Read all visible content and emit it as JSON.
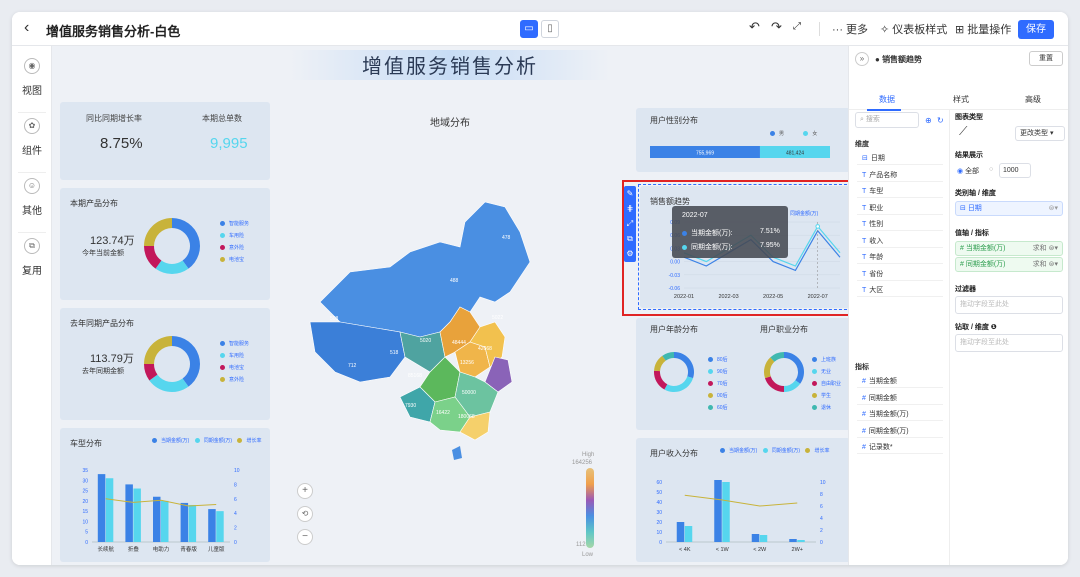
{
  "window": {
    "title": "增值服务销售分析-白色"
  },
  "toolbar": {
    "more": "··· 更多",
    "dashboard_style": "仪表板样式",
    "batch": "批量操作",
    "save": "保存"
  },
  "nav": [
    {
      "label": "视图"
    },
    {
      "label": "组件"
    },
    {
      "label": "其他"
    },
    {
      "label": "复用"
    }
  ],
  "dashboard": {
    "title": "增值服务销售分析"
  },
  "kpi": {
    "yoy_label": "同比同期增长率",
    "yoy_value": "8.75%",
    "orders_label": "本期总单数",
    "orders_value": "9,995"
  },
  "current_product": {
    "title": "本期产品分布",
    "value": "123.74万",
    "caption": "今年当前金额",
    "legend": [
      "智能服务",
      "车用险",
      "意外险",
      "电池宝"
    ]
  },
  "last_product": {
    "title": "去年同期产品分布",
    "value": "113.79万",
    "caption": "去年同期金额",
    "legend": [
      "智能服务",
      "车用险",
      "电池宝",
      "意外险"
    ]
  },
  "car": {
    "title": "车型分布",
    "legend": [
      "当期金额(万)",
      "同期金额(万)",
      "增长率"
    ]
  },
  "region": {
    "title": "地域分布",
    "labels": [
      "478",
      "508",
      "488",
      "5022",
      "5020",
      "518",
      "48444",
      "42668",
      "712",
      "13256",
      "85168",
      "7930",
      "16422",
      "180068",
      "50000"
    ],
    "scale_high": "High",
    "scale_top": "164256",
    "scale_bottom": "112",
    "scale_low": "Low"
  },
  "gender": {
    "title": "用户性别分布",
    "legend": [
      "男",
      "女"
    ],
    "male": "755,969",
    "female": "481,424"
  },
  "sales_trend": {
    "title": "销售额趋势",
    "legend": "同期金额(万)",
    "y_ticks": [
      "0.09",
      "0.06",
      "0.03",
      "0.00",
      "-0.03",
      "-0.06"
    ],
    "x_ticks": [
      "2022-01",
      "2022-03",
      "2022-05",
      "2022-07"
    ]
  },
  "tooltip": {
    "date": "2022-07",
    "row1_label": "当期金额(万):",
    "row1_value": "7.51%",
    "row2_label": "同期金额(万):",
    "row2_value": "7.95%"
  },
  "age": {
    "title": "用户年龄分布",
    "legend": [
      "80后",
      "90后",
      "70后",
      "00后",
      "60后"
    ]
  },
  "job": {
    "title": "用户职业分布",
    "legend": [
      "上班族",
      "无业",
      "自由职业",
      "学生",
      "退休"
    ]
  },
  "income": {
    "title": "用户收入分布",
    "legend": [
      "当期金额(万)",
      "同期金额(万)",
      "增长率"
    ]
  },
  "right_panel": {
    "component": "销售额趋势",
    "reset": "重置",
    "tabs": [
      "数据",
      "样式",
      "高级"
    ],
    "search_placeholder": "搜索",
    "dim_header": "维度",
    "dimensions": [
      "日期",
      "产品名称",
      "车型",
      "职业",
      "性别",
      "收入",
      "年龄",
      "省份",
      "大区"
    ],
    "measure_header": "指标",
    "measures": [
      "当期金额",
      "同期金额",
      "当期金额(万)",
      "同期金额(万)",
      "记录数*"
    ],
    "chart_type_label": "图表类型",
    "change_type": "更改类型",
    "result_label": "结果展示",
    "all": "全部",
    "limit": "1000",
    "category_label": "类别轴 / 维度",
    "category_field": "日期",
    "value_label": "值轴 / 指标",
    "value_field1": "当期金额(万)",
    "value_field2": "同期金额(万)",
    "agg": "求和",
    "filter_label": "过滤器",
    "filter_placeholder": "拖动字段至此处",
    "drill_label": "钻取 / 维度",
    "drill_placeholder": "拖动字段至此处"
  },
  "colors": {
    "accent": "#2f6bff",
    "bar1": "#3b82e6",
    "bar2": "#56d6ee",
    "highlight": "#e02424"
  },
  "chart_data": [
    {
      "type": "pie",
      "title": "本期产品分布",
      "categories": [
        "智能服务",
        "车用险",
        "意外险",
        "电池宝"
      ],
      "values": [
        40,
        20,
        15,
        25
      ]
    },
    {
      "type": "pie",
      "title": "去年同期产品分布",
      "categories": [
        "智能服务",
        "车用险",
        "电池宝",
        "意外险"
      ],
      "values": [
        40,
        25,
        10,
        25
      ]
    },
    {
      "type": "bar",
      "title": "车型分布",
      "categories": [
        "长续航",
        "折叠",
        "电助力",
        "青春版",
        "儿童版"
      ],
      "series": [
        {
          "name": "当期金额(万)",
          "values": [
            33,
            28,
            22,
            19,
            16
          ]
        },
        {
          "name": "同期金额(万)",
          "values": [
            31,
            26,
            20,
            18,
            15
          ]
        },
        {
          "name": "增长率",
          "values": [
            6,
            5.5,
            5.8,
            5,
            5.2
          ]
        }
      ],
      "ylim": [
        0,
        35
      ],
      "y2lim": [
        0,
        10
      ]
    },
    {
      "type": "line",
      "title": "销售额趋势",
      "x": [
        "2022-01",
        "2022-02",
        "2022-03",
        "2022-04",
        "2022-05",
        "2022-06",
        "2022-07",
        "2022-08"
      ],
      "series": [
        {
          "name": "当期金额(万)",
          "values": [
            0.01,
            -0.01,
            0.02,
            0.05,
            0.0,
            -0.02,
            0.07,
            0.01
          ]
        },
        {
          "name": "同期金额(万)",
          "values": [
            0.02,
            0.0,
            0.03,
            0.06,
            0.01,
            -0.01,
            0.08,
            0.02
          ]
        }
      ],
      "ylim": [
        -0.06,
        0.09
      ]
    },
    {
      "type": "bar",
      "title": "用户性别分布",
      "categories": [
        "男",
        "女"
      ],
      "values": [
        755969,
        481424
      ]
    },
    {
      "type": "pie",
      "title": "用户年龄分布",
      "categories": [
        "80后",
        "90后",
        "70后",
        "00后",
        "60后"
      ],
      "values": [
        30,
        28,
        18,
        14,
        10
      ]
    },
    {
      "type": "pie",
      "title": "用户职业分布",
      "categories": [
        "上班族",
        "无业",
        "自由职业",
        "学生",
        "退休"
      ],
      "values": [
        35,
        15,
        20,
        18,
        12
      ]
    },
    {
      "type": "bar",
      "title": "用户收入分布",
      "categories": [
        "< 4K",
        "< 1W",
        "< 2W",
        "2W+"
      ],
      "series": [
        {
          "name": "当期金额(万)",
          "values": [
            20,
            62,
            8,
            3
          ]
        },
        {
          "name": "同期金额(万)",
          "values": [
            16,
            60,
            7,
            2
          ]
        },
        {
          "name": "增长率",
          "values": [
            7.8,
            7.0,
            6.0,
            6.5
          ]
        }
      ],
      "ylim": [
        0,
        60
      ],
      "y2lim": [
        0,
        10
      ]
    }
  ]
}
